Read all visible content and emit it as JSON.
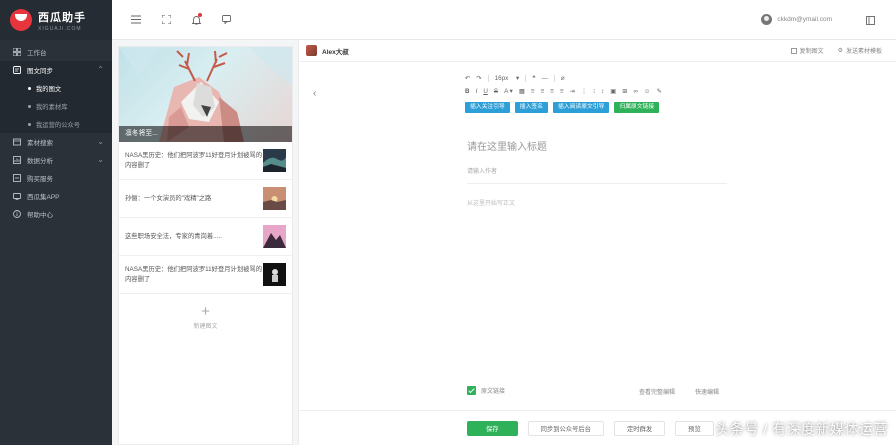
{
  "brand": {
    "title": "西瓜助手",
    "subtitle": "XIGUAJI.COM",
    "color": "#e8343c"
  },
  "sidebar": {
    "items": [
      {
        "label": "工作台",
        "icon": "dashboard-icon"
      },
      {
        "label": "图文同步",
        "icon": "article-icon",
        "active": true,
        "expanded": true,
        "children": [
          {
            "label": "我的图文",
            "active": true
          },
          {
            "label": "我的素材库"
          },
          {
            "label": "我运营的公众号"
          }
        ]
      },
      {
        "label": "素材搜索",
        "icon": "search-icon",
        "chevron": true
      },
      {
        "label": "数据分析",
        "icon": "chart-icon",
        "chevron": true
      },
      {
        "label": "购买服务",
        "icon": "cart-icon"
      },
      {
        "label": "西瓜集APP",
        "icon": "app-icon"
      },
      {
        "label": "帮助中心",
        "icon": "help-icon"
      }
    ]
  },
  "topbar": {
    "user_email": "ckkdm@ymail.com"
  },
  "article_list": {
    "cover_caption": "凛冬将至...",
    "items": [
      {
        "title": "NASA黑历史：他们把阿波罗11好登月计划被骂的内容删了",
        "thumb": "aurora"
      },
      {
        "title": "孙俪：一个女演员的\"戏精\"之路",
        "thumb": "sunset"
      },
      {
        "title": "这些职场安全法，专家的青岗着.....",
        "thumb": "mountain"
      },
      {
        "title": "NASA黑历史：他们把阿波罗11好登月计划被骂的内容删了",
        "thumb": "astronaut"
      }
    ],
    "add_label": "新建图文"
  },
  "editor": {
    "author_name": "Alex大叔",
    "actions": [
      "复制图文",
      "发送素材模板"
    ],
    "font_size": "16px",
    "insert_buttons": [
      {
        "label": "插入关注引导",
        "color": "#2d9fd8"
      },
      {
        "label": "插入签名",
        "color": "#2d9fd8"
      },
      {
        "label": "插入阅读原文引导",
        "color": "#2d9fd8"
      },
      {
        "label": "归属原文链接",
        "color": "#2fb15a"
      }
    ],
    "title_placeholder": "请在这里输入标题",
    "author_placeholder": "请输入作者",
    "body_placeholder": "从这里开始写正文",
    "original_label": "原文链接",
    "bottom_links": [
      "查看完整编辑",
      "快速编辑"
    ],
    "buttons": {
      "save": "保存",
      "sync": "同步到公众号后台",
      "publish": "定时群发",
      "more": "预览"
    }
  },
  "watermark": "头条号 / 有深度新媒体运营"
}
